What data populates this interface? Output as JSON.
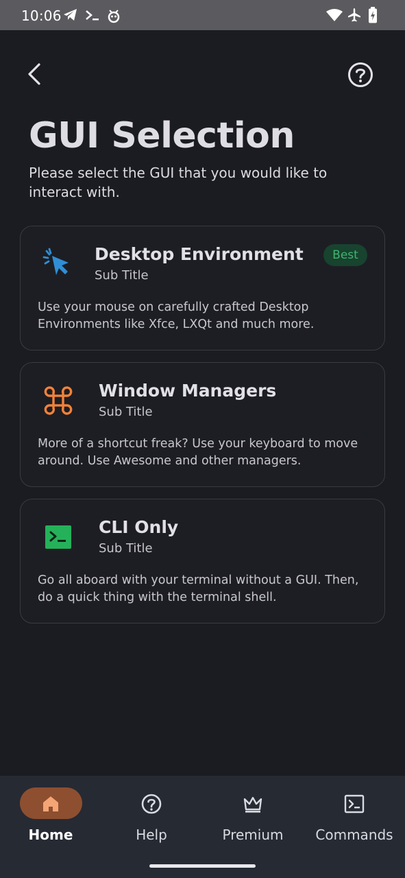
{
  "status_bar": {
    "time": "10:06",
    "left_icons": [
      "telegram-icon",
      "terminal-prompt-icon",
      "bug-icon"
    ],
    "right_icons": [
      "wifi-icon",
      "airplane-icon",
      "battery-charging-icon"
    ]
  },
  "header": {
    "back_icon": "chevron-left-icon",
    "help_icon": "help-circle-icon",
    "title": "GUI Selection",
    "subtitle": "Please select the GUI that you would like to interact with."
  },
  "options": [
    {
      "title": "Desktop Environment",
      "subtitle": "Sub Title",
      "description": "Use your mouse on carefully crafted Desktop Environments like Xfce, LXQt and much more.",
      "badge": "Best",
      "icon": "cursor-click-icon",
      "icon_color": "#2f8fd6"
    },
    {
      "title": "Window Managers",
      "subtitle": "Sub Title",
      "description": "More of a shortcut freak? Use your keyboard to move around. Use Awesome and other managers.",
      "icon": "command-key-icon",
      "icon_color": "#f0823a"
    },
    {
      "title": "CLI Only",
      "subtitle": "Sub Title",
      "description": "Go all aboard with your terminal without a GUI. Then, do a quick thing with the terminal shell.",
      "icon": "terminal-icon",
      "icon_color": "#25b15a"
    }
  ],
  "bottom_nav": {
    "active": "Home",
    "items": [
      {
        "label": "Home",
        "icon": "home-icon"
      },
      {
        "label": "Help",
        "icon": "help-circle-icon"
      },
      {
        "label": "Premium",
        "icon": "crown-icon"
      },
      {
        "label": "Commands",
        "icon": "terminal-box-icon"
      }
    ]
  },
  "colors": {
    "background": "#1b1c21",
    "accent": "#8d4f30",
    "badge_bg": "#17432f",
    "badge_text": "#41b56d"
  }
}
